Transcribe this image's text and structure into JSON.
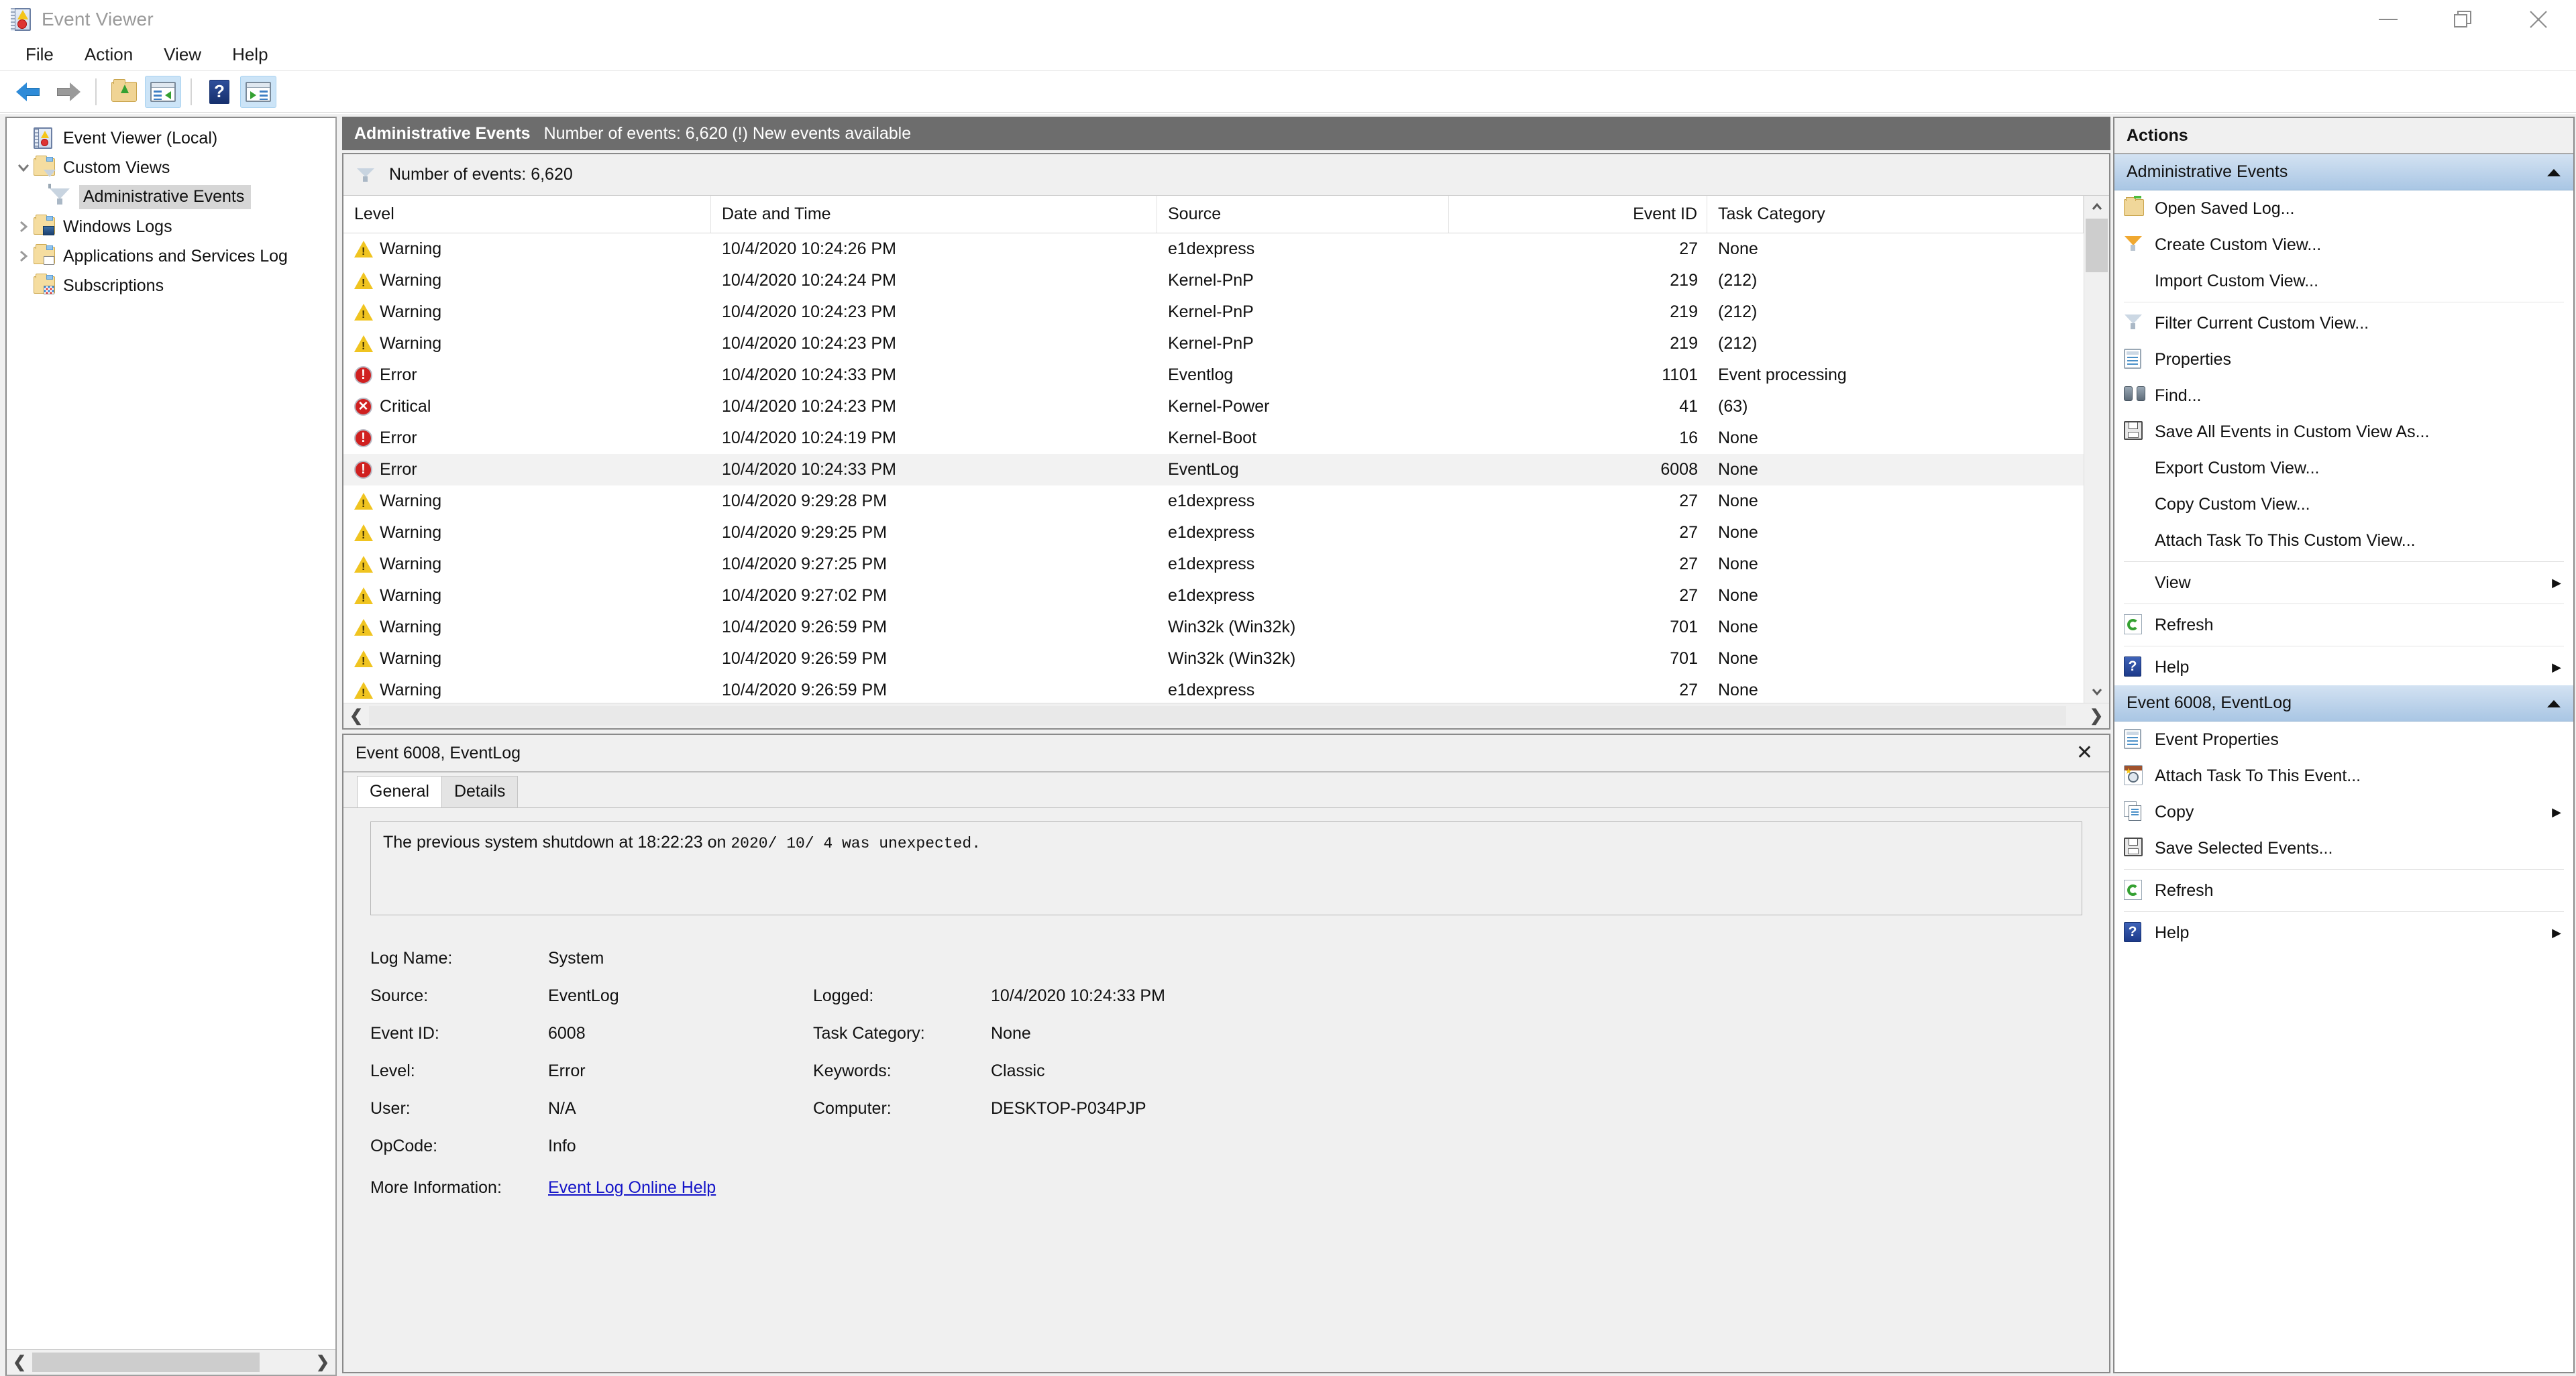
{
  "window": {
    "title": "Event Viewer",
    "icon": "event-viewer-icon",
    "minimize": "—",
    "restore": "restore",
    "close": "✕"
  },
  "menubar": {
    "items": [
      "File",
      "Action",
      "View",
      "Help"
    ]
  },
  "toolbar": {
    "buttons": [
      {
        "name": "back",
        "icon": "back-arrow-icon",
        "active": false
      },
      {
        "name": "forward",
        "icon": "forward-arrow-icon",
        "active": false
      },
      {
        "name": "up-one-level",
        "icon": "folder-up-icon",
        "active": false
      },
      {
        "name": "show-hide-console-tree",
        "icon": "console-tree-icon",
        "active": true
      },
      {
        "name": "help",
        "icon": "help-icon",
        "active": false
      },
      {
        "name": "show-hide-action-pane",
        "icon": "action-pane-icon",
        "active": true
      }
    ]
  },
  "tree": {
    "items": [
      {
        "label": "Event Viewer (Local)",
        "icon": "event-viewer-icon",
        "indent": 0,
        "twisty": "none",
        "selected": false
      },
      {
        "label": "Custom Views",
        "icon": "custom-views-folder-icon",
        "indent": 1,
        "twisty": "expanded",
        "selected": false
      },
      {
        "label": "Administrative Events",
        "icon": "funnel-icon",
        "indent": 2,
        "twisty": "none",
        "selected": true
      },
      {
        "label": "Windows Logs",
        "icon": "windows-logs-folder-icon",
        "indent": 1,
        "twisty": "collapsed",
        "selected": false
      },
      {
        "label": "Applications and Services Log",
        "icon": "apps-services-folder-icon",
        "indent": 1,
        "twisty": "collapsed",
        "selected": false
      },
      {
        "label": "Subscriptions",
        "icon": "subscriptions-folder-icon",
        "indent": 1,
        "twisty": "none",
        "selected": false
      }
    ]
  },
  "center": {
    "header": {
      "title": "Administrative Events",
      "subtitle": "Number of events: 6,620 (!) New events available"
    },
    "filter_bar": {
      "icon": "funnel-icon",
      "text": "Number of events: 6,620"
    },
    "columns": [
      "Level",
      "Date and Time",
      "Source",
      "Event ID",
      "Task Category"
    ],
    "rows": [
      {
        "level": "Warning",
        "level_icon": "warning-icon",
        "date": "10/4/2020 10:24:26 PM",
        "source": "e1dexpress",
        "event_id": "27",
        "task": "None",
        "selected": false
      },
      {
        "level": "Warning",
        "level_icon": "warning-icon",
        "date": "10/4/2020 10:24:24 PM",
        "source": "Kernel-PnP",
        "event_id": "219",
        "task": "(212)",
        "selected": false
      },
      {
        "level": "Warning",
        "level_icon": "warning-icon",
        "date": "10/4/2020 10:24:23 PM",
        "source": "Kernel-PnP",
        "event_id": "219",
        "task": "(212)",
        "selected": false
      },
      {
        "level": "Warning",
        "level_icon": "warning-icon",
        "date": "10/4/2020 10:24:23 PM",
        "source": "Kernel-PnP",
        "event_id": "219",
        "task": "(212)",
        "selected": false
      },
      {
        "level": "Error",
        "level_icon": "error-icon",
        "date": "10/4/2020 10:24:33 PM",
        "source": "Eventlog",
        "event_id": "1101",
        "task": "Event processing",
        "selected": false
      },
      {
        "level": "Critical",
        "level_icon": "critical-icon",
        "date": "10/4/2020 10:24:23 PM",
        "source": "Kernel-Power",
        "event_id": "41",
        "task": "(63)",
        "selected": false
      },
      {
        "level": "Error",
        "level_icon": "error-icon",
        "date": "10/4/2020 10:24:19 PM",
        "source": "Kernel-Boot",
        "event_id": "16",
        "task": "None",
        "selected": false
      },
      {
        "level": "Error",
        "level_icon": "error-icon",
        "date": "10/4/2020 10:24:33 PM",
        "source": "EventLog",
        "event_id": "6008",
        "task": "None",
        "selected": true
      },
      {
        "level": "Warning",
        "level_icon": "warning-icon",
        "date": "10/4/2020 9:29:28 PM",
        "source": "e1dexpress",
        "event_id": "27",
        "task": "None",
        "selected": false
      },
      {
        "level": "Warning",
        "level_icon": "warning-icon",
        "date": "10/4/2020 9:29:25 PM",
        "source": "e1dexpress",
        "event_id": "27",
        "task": "None",
        "selected": false
      },
      {
        "level": "Warning",
        "level_icon": "warning-icon",
        "date": "10/4/2020 9:27:25 PM",
        "source": "e1dexpress",
        "event_id": "27",
        "task": "None",
        "selected": false
      },
      {
        "level": "Warning",
        "level_icon": "warning-icon",
        "date": "10/4/2020 9:27:02 PM",
        "source": "e1dexpress",
        "event_id": "27",
        "task": "None",
        "selected": false
      },
      {
        "level": "Warning",
        "level_icon": "warning-icon",
        "date": "10/4/2020 9:26:59 PM",
        "source": "Win32k (Win32k)",
        "event_id": "701",
        "task": "None",
        "selected": false
      },
      {
        "level": "Warning",
        "level_icon": "warning-icon",
        "date": "10/4/2020 9:26:59 PM",
        "source": "Win32k (Win32k)",
        "event_id": "701",
        "task": "None",
        "selected": false
      },
      {
        "level": "Warning",
        "level_icon": "warning-icon",
        "date": "10/4/2020 9:26:59 PM",
        "source": "e1dexpress",
        "event_id": "27",
        "task": "None",
        "selected": false
      }
    ]
  },
  "detail": {
    "title": "Event 6008, EventLog",
    "close_icon": "close-icon",
    "tabs": [
      {
        "label": "General",
        "active": true
      },
      {
        "label": "Details",
        "active": false
      }
    ],
    "description_prefix": "The previous system shutdown at 18:22:23 on",
    "description_mono": "2020/  10/  4 was unexpected.",
    "fields_left": [
      {
        "label": "Log Name:",
        "value": "System"
      },
      {
        "label": "Source:",
        "value": "EventLog"
      },
      {
        "label": "Event ID:",
        "value": "6008"
      },
      {
        "label": "Level:",
        "value": "Error"
      },
      {
        "label": "User:",
        "value": "N/A"
      },
      {
        "label": "OpCode:",
        "value": "Info"
      }
    ],
    "fields_right": [
      {
        "label": "Logged:",
        "value": "10/4/2020 10:24:33 PM"
      },
      {
        "label": "Task Category:",
        "value": "None"
      },
      {
        "label": "Keywords:",
        "value": "Classic"
      },
      {
        "label": "Computer:",
        "value": "DESKTOP-P034PJP"
      }
    ],
    "more_info_label": "More Information:",
    "more_info_link": "Event Log Online Help"
  },
  "actions": {
    "title": "Actions",
    "groups": [
      {
        "title": "Administrative Events",
        "collapse_icon": "chevron-up-icon",
        "items": [
          {
            "label": "Open Saved Log...",
            "icon": "open-saved-log-icon",
            "submenu": false,
            "sep_after": false
          },
          {
            "label": "Create Custom View...",
            "icon": "create-custom-view-icon",
            "submenu": false,
            "sep_after": false
          },
          {
            "label": "Import Custom View...",
            "icon": "none",
            "submenu": false,
            "sep_after": true
          },
          {
            "label": "Filter Current Custom View...",
            "icon": "filter-icon",
            "submenu": false,
            "sep_after": false
          },
          {
            "label": "Properties",
            "icon": "properties-icon",
            "submenu": false,
            "sep_after": false
          },
          {
            "label": "Find...",
            "icon": "find-icon",
            "submenu": false,
            "sep_after": false
          },
          {
            "label": "Save All Events in Custom View As...",
            "icon": "save-icon",
            "submenu": false,
            "sep_after": false
          },
          {
            "label": "Export Custom View...",
            "icon": "none",
            "submenu": false,
            "sep_after": false
          },
          {
            "label": "Copy Custom View...",
            "icon": "none",
            "submenu": false,
            "sep_after": false
          },
          {
            "label": "Attach Task To This Custom View...",
            "icon": "none",
            "submenu": false,
            "sep_after": true
          },
          {
            "label": "View",
            "icon": "none",
            "submenu": true,
            "sep_after": true
          },
          {
            "label": "Refresh",
            "icon": "refresh-icon",
            "submenu": false,
            "sep_after": true
          },
          {
            "label": "Help",
            "icon": "help-icon",
            "submenu": true,
            "sep_after": false
          }
        ]
      },
      {
        "title": "Event 6008, EventLog",
        "collapse_icon": "chevron-up-icon",
        "items": [
          {
            "label": "Event Properties",
            "icon": "properties-icon",
            "submenu": false,
            "sep_after": false
          },
          {
            "label": "Attach Task To This Event...",
            "icon": "attach-task-icon",
            "submenu": false,
            "sep_after": false
          },
          {
            "label": "Copy",
            "icon": "copy-icon",
            "submenu": true,
            "sep_after": false
          },
          {
            "label": "Save Selected Events...",
            "icon": "save-icon",
            "submenu": false,
            "sep_after": true
          },
          {
            "label": "Refresh",
            "icon": "refresh-icon",
            "submenu": false,
            "sep_after": true
          },
          {
            "label": "Help",
            "icon": "help-icon",
            "submenu": true,
            "sep_after": false
          }
        ]
      }
    ]
  }
}
